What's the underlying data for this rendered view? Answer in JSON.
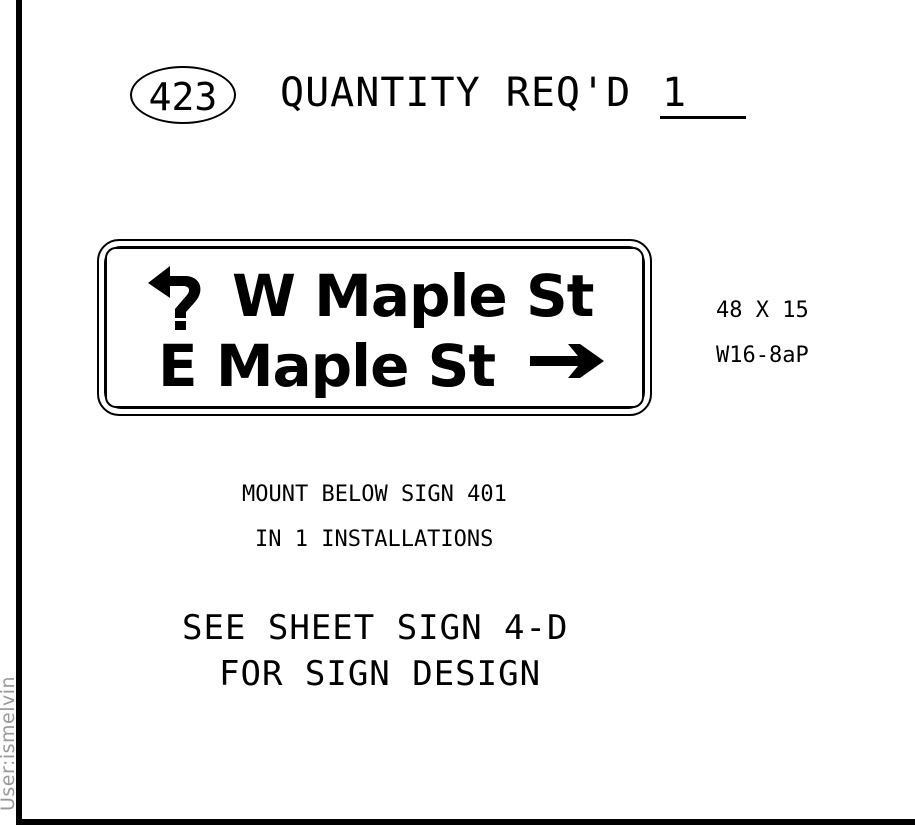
{
  "sheet": {
    "sign_number": "423",
    "quantity_label": "QUANTITY REQ'D",
    "quantity_value": "1",
    "user_stamp": "User:ismelvin"
  },
  "sign": {
    "line1": "W  Maple  St",
    "line2": "E  Maple  St",
    "line1_arrow_icon": "left-turn-arrow-icon",
    "line2_arrow_icon": "right-arrow-icon",
    "size": "48 X 15",
    "code": "W16-8aP"
  },
  "notes": {
    "mount": "MOUNT BELOW SIGN 401",
    "installations": "IN 1 INSTALLATIONS"
  },
  "reference": {
    "line1": "SEE SHEET SIGN 4-D",
    "line2": "FOR SIGN DESIGN"
  }
}
